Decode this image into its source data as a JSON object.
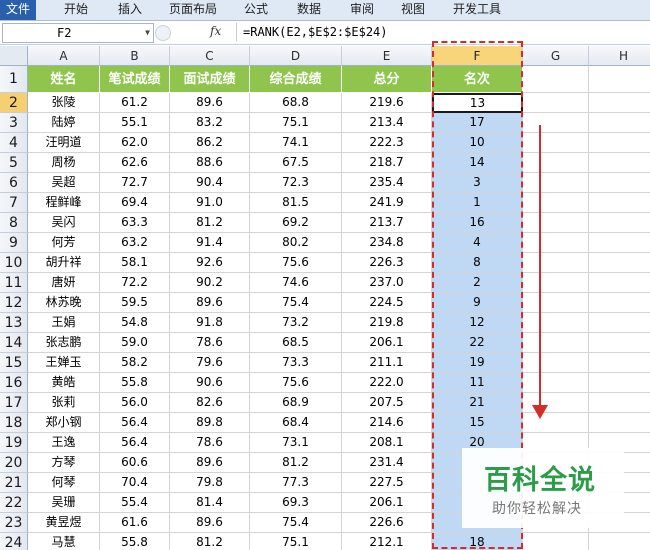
{
  "ribbon_tabs": [
    "文件",
    "开始",
    "插入",
    "页面布局",
    "公式",
    "数据",
    "审阅",
    "视图",
    "开发工具"
  ],
  "formula_bar": {
    "name_box": "F2",
    "fx_label": "fx",
    "formula": "=RANK(E2,$E$2:$E$24)"
  },
  "columns": [
    "A",
    "B",
    "C",
    "D",
    "E",
    "F",
    "G",
    "H"
  ],
  "selected_column": "F",
  "headers": [
    "姓名",
    "笔试成绩",
    "面试成绩",
    "综合成绩",
    "总分",
    "名次"
  ],
  "rows": [
    {
      "row": "2",
      "name": "张陵",
      "written": "61.2",
      "interview": "89.6",
      "overall": "68.8",
      "total": "219.6",
      "rank": "13"
    },
    {
      "row": "3",
      "name": "陆婷",
      "written": "55.1",
      "interview": "83.2",
      "overall": "75.1",
      "total": "213.4",
      "rank": "17"
    },
    {
      "row": "4",
      "name": "汪明道",
      "written": "62.0",
      "interview": "86.2",
      "overall": "74.1",
      "total": "222.3",
      "rank": "10"
    },
    {
      "row": "5",
      "name": "周杨",
      "written": "62.6",
      "interview": "88.6",
      "overall": "67.5",
      "total": "218.7",
      "rank": "14"
    },
    {
      "row": "6",
      "name": "吴超",
      "written": "72.7",
      "interview": "90.4",
      "overall": "72.3",
      "total": "235.4",
      "rank": "3"
    },
    {
      "row": "7",
      "name": "程鲜峰",
      "written": "69.4",
      "interview": "91.0",
      "overall": "81.5",
      "total": "241.9",
      "rank": "1"
    },
    {
      "row": "8",
      "name": "吴闪",
      "written": "63.3",
      "interview": "81.2",
      "overall": "69.2",
      "total": "213.7",
      "rank": "16"
    },
    {
      "row": "9",
      "name": "何芳",
      "written": "63.2",
      "interview": "91.4",
      "overall": "80.2",
      "total": "234.8",
      "rank": "4"
    },
    {
      "row": "10",
      "name": "胡升祥",
      "written": "58.1",
      "interview": "92.6",
      "overall": "75.6",
      "total": "226.3",
      "rank": "8"
    },
    {
      "row": "11",
      "name": "唐妍",
      "written": "72.2",
      "interview": "90.2",
      "overall": "74.6",
      "total": "237.0",
      "rank": "2"
    },
    {
      "row": "12",
      "name": "林苏晚",
      "written": "59.5",
      "interview": "89.6",
      "overall": "75.4",
      "total": "224.5",
      "rank": "9"
    },
    {
      "row": "13",
      "name": "王娟",
      "written": "54.8",
      "interview": "91.8",
      "overall": "73.2",
      "total": "219.8",
      "rank": "12"
    },
    {
      "row": "14",
      "name": "张志鹏",
      "written": "59.0",
      "interview": "78.6",
      "overall": "68.5",
      "total": "206.1",
      "rank": "22"
    },
    {
      "row": "15",
      "name": "王婵玉",
      "written": "58.2",
      "interview": "79.6",
      "overall": "73.3",
      "total": "211.1",
      "rank": "19"
    },
    {
      "row": "16",
      "name": "黄皓",
      "written": "55.8",
      "interview": "90.6",
      "overall": "75.6",
      "total": "222.0",
      "rank": "11"
    },
    {
      "row": "17",
      "name": "张莉",
      "written": "56.0",
      "interview": "82.6",
      "overall": "68.9",
      "total": "207.5",
      "rank": "21"
    },
    {
      "row": "18",
      "name": "郑小钢",
      "written": "56.4",
      "interview": "89.8",
      "overall": "68.4",
      "total": "214.6",
      "rank": "15"
    },
    {
      "row": "19",
      "name": "王逸",
      "written": "56.4",
      "interview": "78.6",
      "overall": "73.1",
      "total": "208.1",
      "rank": "20"
    },
    {
      "row": "20",
      "name": "方琴",
      "written": "60.6",
      "interview": "89.6",
      "overall": "81.2",
      "total": "231.4",
      "rank": ""
    },
    {
      "row": "21",
      "name": "何琴",
      "written": "70.4",
      "interview": "79.8",
      "overall": "77.3",
      "total": "227.5",
      "rank": ""
    },
    {
      "row": "22",
      "name": "吴珊",
      "written": "55.4",
      "interview": "81.4",
      "overall": "69.3",
      "total": "206.1",
      "rank": ""
    },
    {
      "row": "23",
      "name": "黄昱煜",
      "written": "61.6",
      "interview": "89.6",
      "overall": "75.4",
      "total": "226.6",
      "rank": ""
    },
    {
      "row": "24",
      "name": "马慧",
      "written": "55.8",
      "interview": "81.2",
      "overall": "75.1",
      "total": "212.1",
      "rank": "18"
    }
  ],
  "watermark": {
    "title": "百科全说",
    "subtitle": "助你轻松解决"
  },
  "colors": {
    "header_green": "#8fc54d",
    "rank_fill": "#bfd9f4",
    "annotation_red": "#d42b2b",
    "file_tab": "#2a5fac"
  }
}
